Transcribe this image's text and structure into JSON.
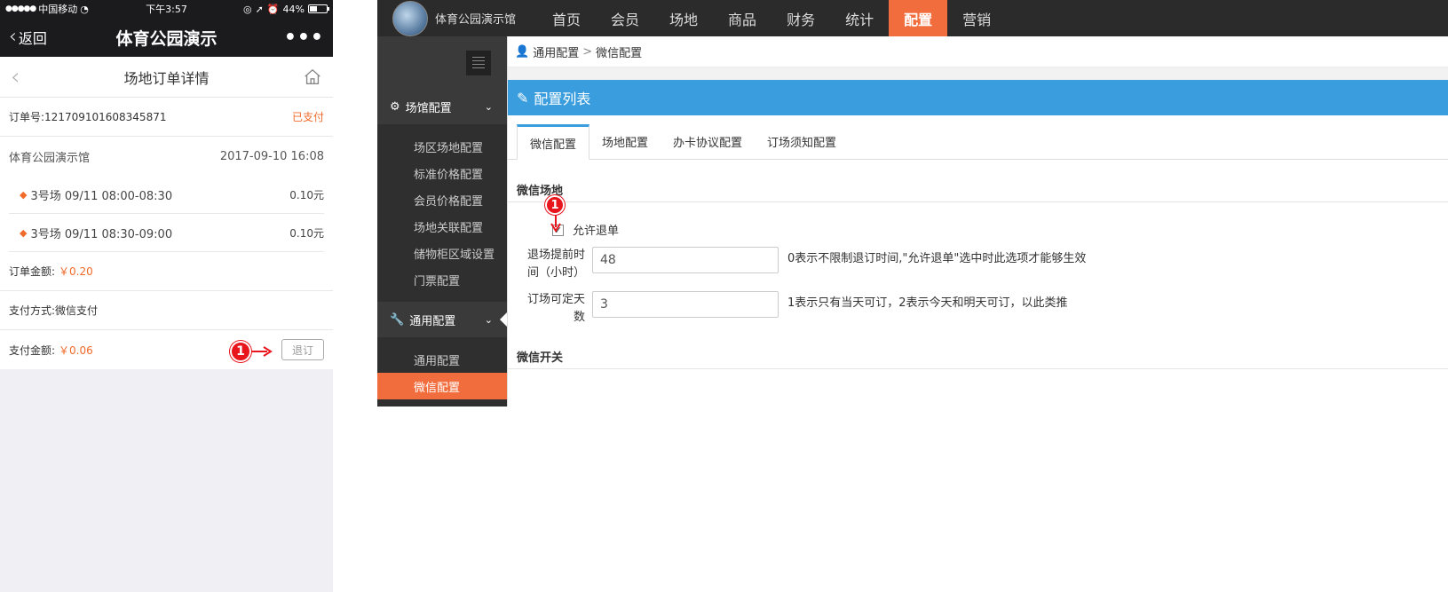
{
  "mobile": {
    "status": {
      "carrier": "中国移动",
      "time": "下午3:57",
      "battery": "44%",
      "battery_level": 0.44
    },
    "nav": {
      "back_label": "返回",
      "title": "体育公园演示",
      "more": "•••"
    },
    "page_title": "场地订单详情",
    "order": {
      "number_label": "订单号:",
      "number": "121709101608345871",
      "status": "已支付",
      "venue": "体育公园演示馆",
      "datetime": "2017-09-10 16:08",
      "items": [
        {
          "desc": "3号场 09/11 08:00-08:30",
          "price": "0.10元"
        },
        {
          "desc": "3号场 09/11 08:30-09:00",
          "price": "0.10元"
        }
      ],
      "amount_label": "订单金额:",
      "amount": "￥0.20",
      "pay_method_label": "支付方式:",
      "pay_method": "微信支付",
      "paid_label": "支付金额:",
      "paid": "￥0.06",
      "refund_button": "退订",
      "badge": "1"
    }
  },
  "admin": {
    "brand": "体育公园演示馆",
    "menu": [
      "首页",
      "会员",
      "场地",
      "商品",
      "财务",
      "统计",
      "配置",
      "营销"
    ],
    "active_menu": "配置",
    "sidebar": {
      "group1": "场馆配置",
      "group1_items": [
        "场区场地配置",
        "标准价格配置",
        "会员价格配置",
        "场地关联配置",
        "储物柜区域设置",
        "门票配置"
      ],
      "group2": "通用配置",
      "group2_items": [
        "通用配置",
        "微信配置"
      ]
    },
    "breadcrumb": {
      "root": "通用配置",
      "sep": ">",
      "current": "微信配置"
    },
    "panel_title": "配置列表",
    "tabs": [
      "微信配置",
      "场地配置",
      "办卡协议配置",
      "订场须知配置"
    ],
    "section1": "微信场地",
    "allow_refund_label": "允许退单",
    "allow_refund_checked": true,
    "badge": "1",
    "fields": [
      {
        "label": "退场提前时间（小时）",
        "value": "48",
        "help": "0表示不限制退订时间,\"允许退单\"选中时此选项才能够生效"
      },
      {
        "label": "订场可定天数",
        "value": "3",
        "help": "1表示只有当天可订，2表示今天和明天可订，以此类推"
      }
    ],
    "section2": "微信开关"
  }
}
